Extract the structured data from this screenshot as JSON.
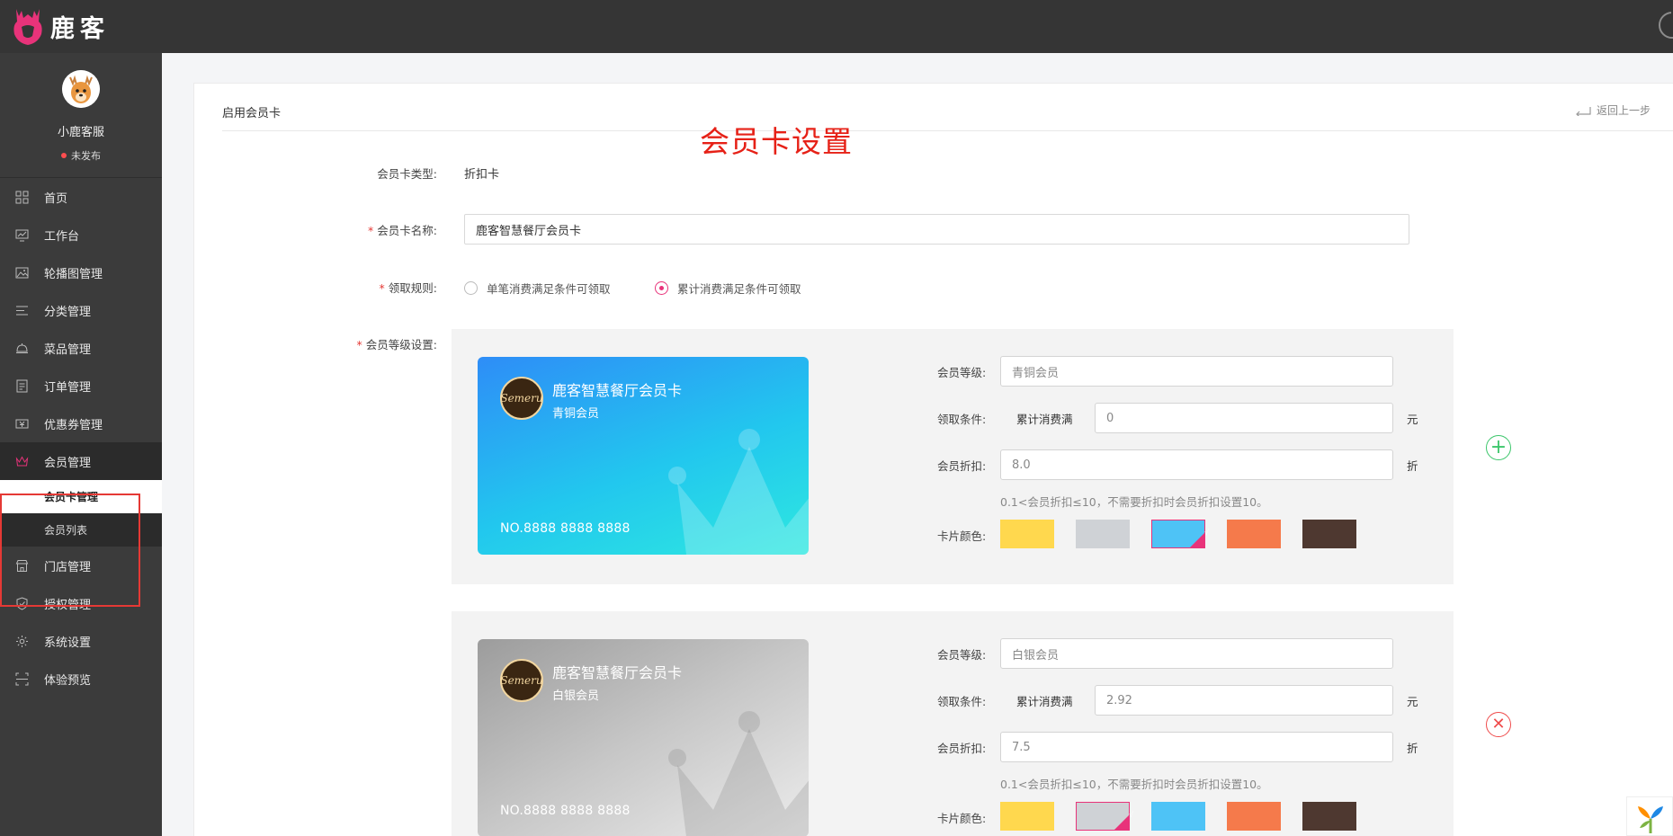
{
  "app": {
    "logo_text": "鹿客"
  },
  "sidebar": {
    "profile": {
      "name": "小鹿客服",
      "status": "未发布"
    },
    "items": [
      {
        "label": "首页",
        "icon": "grid-icon"
      },
      {
        "label": "工作台",
        "icon": "monitor-icon"
      },
      {
        "label": "轮播图管理",
        "icon": "image-icon"
      },
      {
        "label": "分类管理",
        "icon": "list-icon"
      },
      {
        "label": "菜品管理",
        "icon": "dish-cover-icon"
      },
      {
        "label": "订单管理",
        "icon": "order-icon"
      },
      {
        "label": "优惠券管理",
        "icon": "coupon-icon"
      },
      {
        "label": "会员管理",
        "icon": "crown-icon",
        "active": true
      },
      {
        "label": "门店管理",
        "icon": "store-icon"
      },
      {
        "label": "授权管理",
        "icon": "shield-icon"
      },
      {
        "label": "系统设置",
        "icon": "gear-icon"
      },
      {
        "label": "体验预览",
        "icon": "scan-icon"
      }
    ],
    "sub_items": [
      {
        "label": "会员卡管理",
        "selected": true
      },
      {
        "label": "会员列表",
        "selected": false
      }
    ]
  },
  "panel": {
    "title": "启用会员卡",
    "back_label": "返回上一步",
    "annotation": "会员卡设置"
  },
  "form": {
    "type_label": "会员卡类型:",
    "type_value": "折扣卡",
    "name_label": "会员卡名称:",
    "name_value": "鹿客智慧餐厅会员卡",
    "rule_label": "领取规则:",
    "rule_options": [
      {
        "label": "单笔消费满足条件可领取",
        "checked": false
      },
      {
        "label": "累计消费满足条件可领取",
        "checked": true
      }
    ],
    "level_label": "会员等级设置:",
    "level_field_label": "会员等级:",
    "condition_label": "领取条件:",
    "condition_prefix": "累计消费满",
    "condition_unit": "元",
    "discount_label": "会员折扣:",
    "discount_unit": "折",
    "discount_hint": "0.1<会员折扣≤10，不需要折扣时会员折扣设置10。",
    "color_label": "卡片颜色:",
    "swatch_colors": [
      "#ffd84e",
      "#cfd2d6",
      "#4ec3f6",
      "#f57a4b",
      "#4e3830"
    ],
    "levels": [
      {
        "card_name": "鹿客智慧餐厅会员卡",
        "card_level": "青铜会员",
        "card_no": "NO.8888 8888 8888",
        "card_logo": "Semeru",
        "level_placeholder": "青铜会员",
        "condition_value": "0",
        "discount_value": "8.0",
        "selected_color": 2,
        "action": "add"
      },
      {
        "card_name": "鹿客智慧餐厅会员卡",
        "card_level": "白银会员",
        "card_no": "NO.8888 8888 8888",
        "card_logo": "Semeru",
        "level_placeholder": "白银会员",
        "condition_value": "2.92",
        "discount_value": "7.5",
        "selected_color": 1,
        "action": "remove"
      }
    ]
  }
}
